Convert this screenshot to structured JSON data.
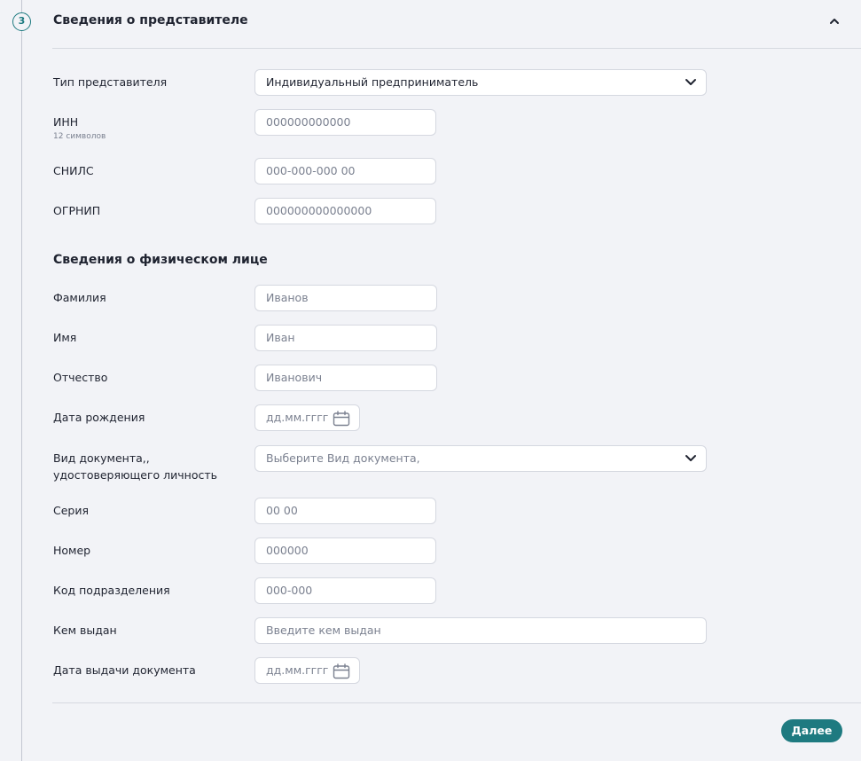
{
  "section": {
    "step_number": "3",
    "title": "Сведения о представителе"
  },
  "representative": {
    "type_label": "Тип представителя",
    "type_value": "Индивидуальный предприниматель",
    "inn_label": "ИНН",
    "inn_hint": "12 символов",
    "inn_placeholder": "000000000000",
    "snils_label": "СНИЛС",
    "snils_placeholder": "000-000-000 00",
    "ogrnip_label": "ОГРНИП",
    "ogrnip_placeholder": "000000000000000"
  },
  "person": {
    "title": "Сведения о физическом лице",
    "last_name_label": "Фамилия",
    "last_name_placeholder": "Иванов",
    "first_name_label": "Имя",
    "first_name_placeholder": "Иван",
    "patronymic_label": "Отчество",
    "patronymic_placeholder": "Иванович",
    "birth_date_label": "Дата рождения",
    "birth_date_placeholder": "дд.мм.гггг",
    "doc_type_label_line1": "Вид документа,,",
    "doc_type_label_line2": "удостоверяющего личность",
    "doc_type_placeholder": "Выберите Вид документа,",
    "series_label": "Серия",
    "series_placeholder": "00 00",
    "number_label": "Номер",
    "number_placeholder": "000000",
    "division_code_label": "Код подразделения",
    "division_code_placeholder": "000-000",
    "issued_by_label": "Кем выдан",
    "issued_by_placeholder": "Введите кем выдан",
    "issue_date_label": "Дата выдачи документа",
    "issue_date_placeholder": "дд.мм.гггг"
  },
  "actions": {
    "next_label": "Далее"
  },
  "colors": {
    "accent": "#1e7a80",
    "background": "#f2f3f7"
  },
  "icons": {
    "collapse": "chevron-up-icon",
    "dropdown": "chevron-down-icon",
    "date": "calendar-icon"
  }
}
